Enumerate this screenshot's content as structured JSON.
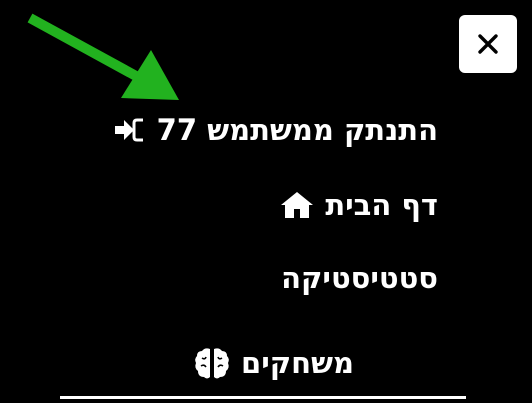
{
  "close": {
    "label": "×",
    "icon": "close-icon"
  },
  "annotation": {
    "color": "#22b21f",
    "icon": "arrow-icon"
  },
  "menu": {
    "items": [
      {
        "label": "התנתק ממשתמש 77",
        "icon": "logout-icon"
      },
      {
        "label": "דף הבית",
        "icon": "home-icon"
      },
      {
        "label": "סטטיסטיקה",
        "icon": ""
      },
      {
        "label": "משחקים",
        "icon": "brain-icon"
      }
    ]
  },
  "colors": {
    "background": "#000000",
    "text": "#ffffff",
    "close_bg": "#ffffff"
  }
}
